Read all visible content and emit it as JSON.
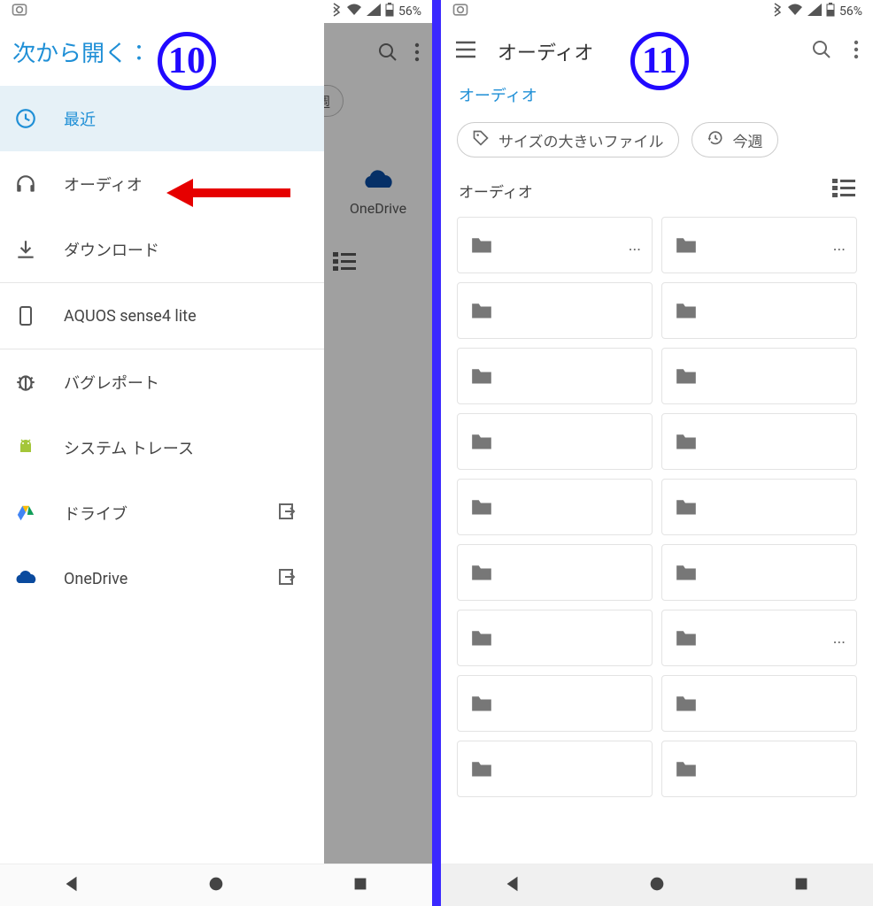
{
  "statusbar": {
    "battery": "56%"
  },
  "steps": {
    "s10": "10",
    "s11": "11"
  },
  "left": {
    "title": "次から開く：",
    "items": {
      "recent": "最近",
      "audio": "オーディオ",
      "download": "ダウンロード",
      "device": "AQUOS sense4 lite",
      "bug": "バグレポート",
      "trace": "システム トレース",
      "drive": "ドライブ",
      "onedrive": "OneDrive"
    },
    "bg": {
      "chip": "今週",
      "onedrive": "OneDrive"
    }
  },
  "right": {
    "title": "オーディオ",
    "crumb": "オーディオ",
    "chip_large": "サイズの大きいファイル",
    "chip_week": "今週",
    "section": "オーディオ",
    "folders": [
      {
        "name": "",
        "more": "..."
      },
      {
        "name": "",
        "more": "..."
      },
      {
        "name": "",
        "more": ""
      },
      {
        "name": "",
        "more": ""
      },
      {
        "name": "",
        "more": ""
      },
      {
        "name": "",
        "more": ""
      },
      {
        "name": "",
        "more": ""
      },
      {
        "name": "",
        "more": ""
      },
      {
        "name": "",
        "more": ""
      },
      {
        "name": "",
        "more": ""
      },
      {
        "name": "",
        "more": ""
      },
      {
        "name": "",
        "more": ""
      },
      {
        "name": "",
        "more": ""
      },
      {
        "name": "",
        "more": "..."
      },
      {
        "name": "",
        "more": ""
      },
      {
        "name": "",
        "more": ""
      },
      {
        "name": "",
        "more": ""
      },
      {
        "name": "",
        "more": ""
      }
    ]
  }
}
